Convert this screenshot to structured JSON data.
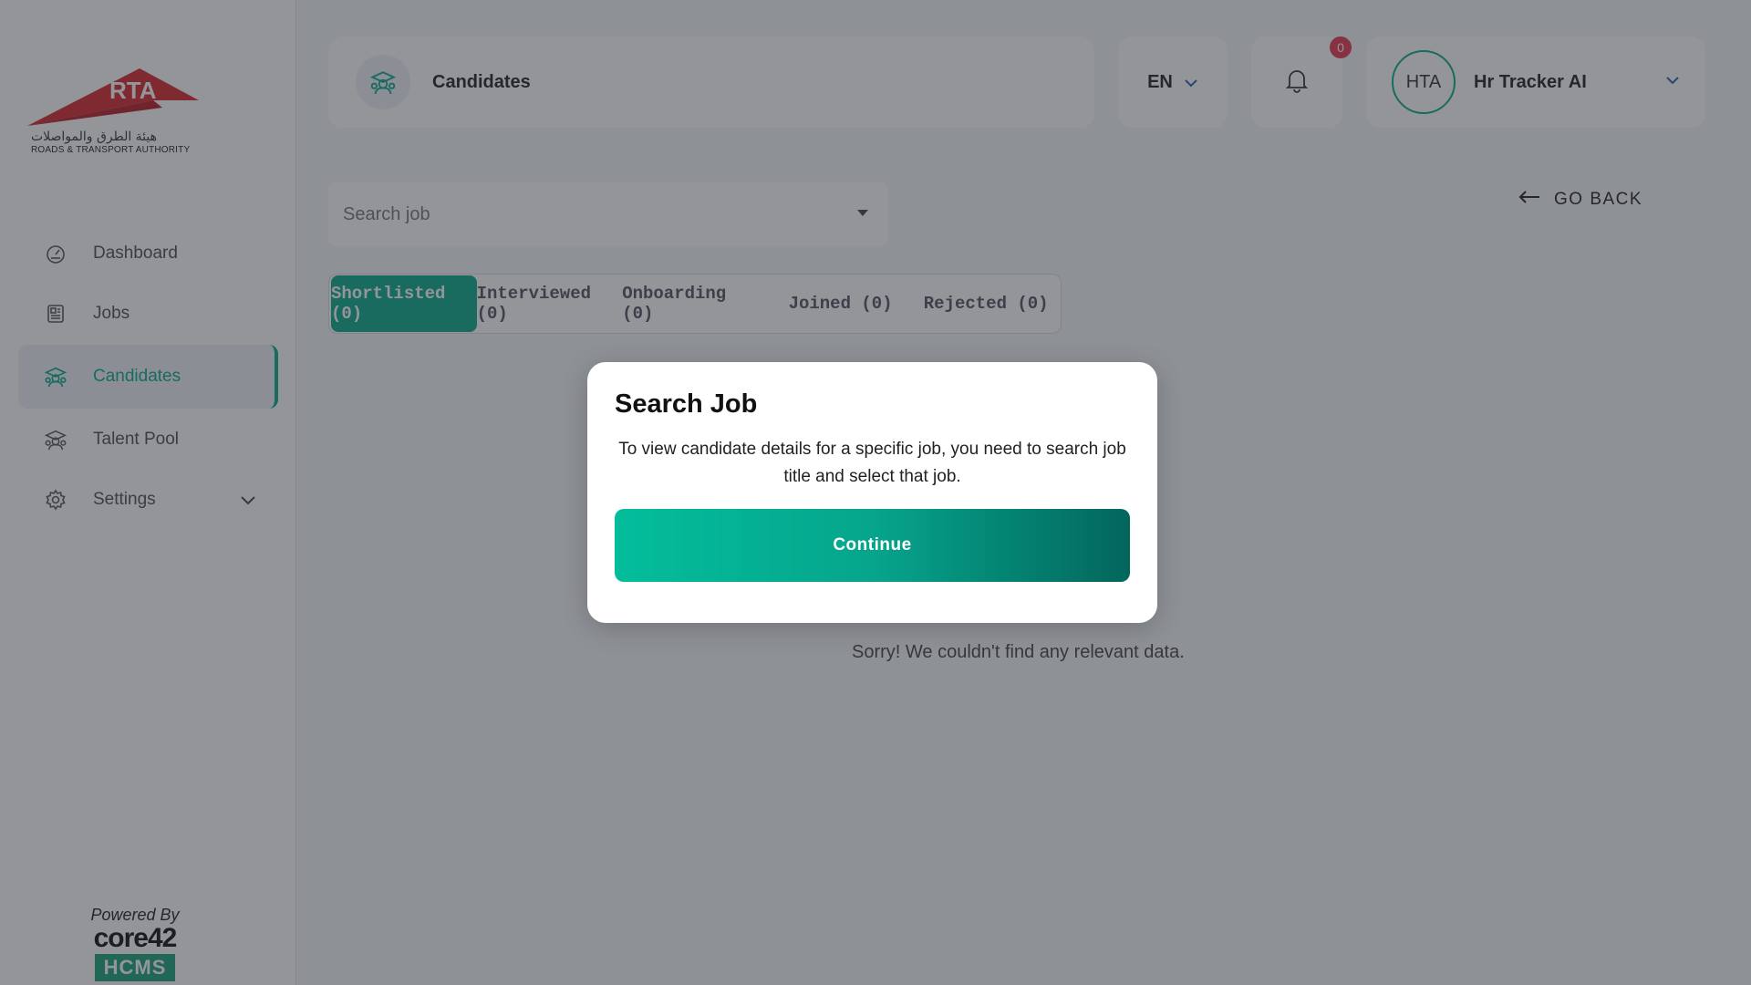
{
  "brand": {
    "logo_text": "RTA",
    "arabic_name": "هيئة الطرق والمواصلات",
    "english_name": "ROADS & TRANSPORT AUTHORITY",
    "powered_by": "Powered By",
    "powered_brand": "core42",
    "powered_product": "HCMS",
    "accent_color": "#0aa88a",
    "logo_color": "#d7262f"
  },
  "sidebar": {
    "items": [
      {
        "label": "Dashboard",
        "icon": "dashboard-icon"
      },
      {
        "label": "Jobs",
        "icon": "jobs-icon"
      },
      {
        "label": "Candidates",
        "icon": "candidates-icon",
        "active": true
      },
      {
        "label": "Talent Pool",
        "icon": "talent-pool-icon"
      },
      {
        "label": "Settings",
        "icon": "gear-icon",
        "expandable": true
      }
    ]
  },
  "header": {
    "title": "Candidates",
    "language": "EN",
    "notification_count": "0",
    "user_initials": "HTA",
    "user_name": "Hr Tracker AI"
  },
  "search": {
    "placeholder": "Search job",
    "value": ""
  },
  "go_back_label": "GO BACK",
  "tabs": [
    {
      "label": "Shortlisted (0)",
      "active": true
    },
    {
      "label": "Interviewed (0)"
    },
    {
      "label": "Onboarding (0)"
    },
    {
      "label": "Joined (0)"
    },
    {
      "label": "Rejected (0)"
    }
  ],
  "empty_message": "Sorry! We couldn't find any relevant data.",
  "modal": {
    "title": "Search Job",
    "message": "To view candidate details for a specific job, you need to search job title and select that job.",
    "button_label": "Continue"
  }
}
